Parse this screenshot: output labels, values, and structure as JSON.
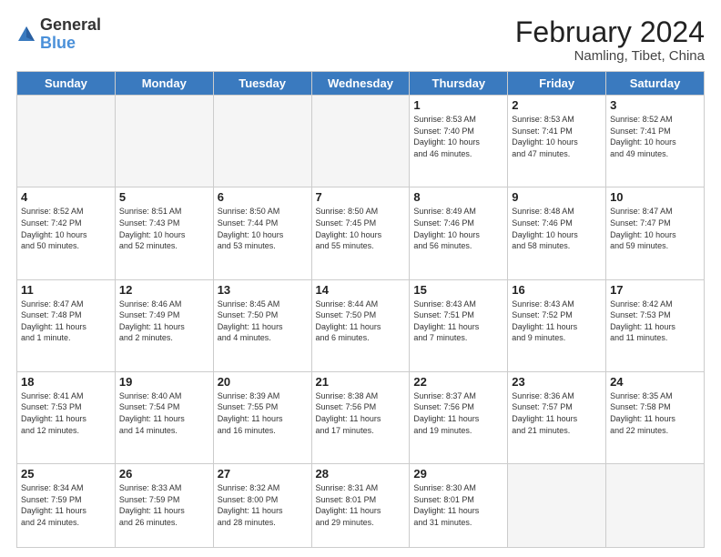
{
  "header": {
    "logo_general": "General",
    "logo_blue": "Blue",
    "month_year": "February 2024",
    "location": "Namling, Tibet, China"
  },
  "days_of_week": [
    "Sunday",
    "Monday",
    "Tuesday",
    "Wednesday",
    "Thursday",
    "Friday",
    "Saturday"
  ],
  "weeks": [
    [
      {
        "day": "",
        "info": "",
        "empty": true
      },
      {
        "day": "",
        "info": "",
        "empty": true
      },
      {
        "day": "",
        "info": "",
        "empty": true
      },
      {
        "day": "",
        "info": "",
        "empty": true
      },
      {
        "day": "1",
        "info": "Sunrise: 8:53 AM\nSunset: 7:40 PM\nDaylight: 10 hours\nand 46 minutes.",
        "empty": false
      },
      {
        "day": "2",
        "info": "Sunrise: 8:53 AM\nSunset: 7:41 PM\nDaylight: 10 hours\nand 47 minutes.",
        "empty": false
      },
      {
        "day": "3",
        "info": "Sunrise: 8:52 AM\nSunset: 7:41 PM\nDaylight: 10 hours\nand 49 minutes.",
        "empty": false
      }
    ],
    [
      {
        "day": "4",
        "info": "Sunrise: 8:52 AM\nSunset: 7:42 PM\nDaylight: 10 hours\nand 50 minutes.",
        "empty": false
      },
      {
        "day": "5",
        "info": "Sunrise: 8:51 AM\nSunset: 7:43 PM\nDaylight: 10 hours\nand 52 minutes.",
        "empty": false
      },
      {
        "day": "6",
        "info": "Sunrise: 8:50 AM\nSunset: 7:44 PM\nDaylight: 10 hours\nand 53 minutes.",
        "empty": false
      },
      {
        "day": "7",
        "info": "Sunrise: 8:50 AM\nSunset: 7:45 PM\nDaylight: 10 hours\nand 55 minutes.",
        "empty": false
      },
      {
        "day": "8",
        "info": "Sunrise: 8:49 AM\nSunset: 7:46 PM\nDaylight: 10 hours\nand 56 minutes.",
        "empty": false
      },
      {
        "day": "9",
        "info": "Sunrise: 8:48 AM\nSunset: 7:46 PM\nDaylight: 10 hours\nand 58 minutes.",
        "empty": false
      },
      {
        "day": "10",
        "info": "Sunrise: 8:47 AM\nSunset: 7:47 PM\nDaylight: 10 hours\nand 59 minutes.",
        "empty": false
      }
    ],
    [
      {
        "day": "11",
        "info": "Sunrise: 8:47 AM\nSunset: 7:48 PM\nDaylight: 11 hours\nand 1 minute.",
        "empty": false
      },
      {
        "day": "12",
        "info": "Sunrise: 8:46 AM\nSunset: 7:49 PM\nDaylight: 11 hours\nand 2 minutes.",
        "empty": false
      },
      {
        "day": "13",
        "info": "Sunrise: 8:45 AM\nSunset: 7:50 PM\nDaylight: 11 hours\nand 4 minutes.",
        "empty": false
      },
      {
        "day": "14",
        "info": "Sunrise: 8:44 AM\nSunset: 7:50 PM\nDaylight: 11 hours\nand 6 minutes.",
        "empty": false
      },
      {
        "day": "15",
        "info": "Sunrise: 8:43 AM\nSunset: 7:51 PM\nDaylight: 11 hours\nand 7 minutes.",
        "empty": false
      },
      {
        "day": "16",
        "info": "Sunrise: 8:43 AM\nSunset: 7:52 PM\nDaylight: 11 hours\nand 9 minutes.",
        "empty": false
      },
      {
        "day": "17",
        "info": "Sunrise: 8:42 AM\nSunset: 7:53 PM\nDaylight: 11 hours\nand 11 minutes.",
        "empty": false
      }
    ],
    [
      {
        "day": "18",
        "info": "Sunrise: 8:41 AM\nSunset: 7:53 PM\nDaylight: 11 hours\nand 12 minutes.",
        "empty": false
      },
      {
        "day": "19",
        "info": "Sunrise: 8:40 AM\nSunset: 7:54 PM\nDaylight: 11 hours\nand 14 minutes.",
        "empty": false
      },
      {
        "day": "20",
        "info": "Sunrise: 8:39 AM\nSunset: 7:55 PM\nDaylight: 11 hours\nand 16 minutes.",
        "empty": false
      },
      {
        "day": "21",
        "info": "Sunrise: 8:38 AM\nSunset: 7:56 PM\nDaylight: 11 hours\nand 17 minutes.",
        "empty": false
      },
      {
        "day": "22",
        "info": "Sunrise: 8:37 AM\nSunset: 7:56 PM\nDaylight: 11 hours\nand 19 minutes.",
        "empty": false
      },
      {
        "day": "23",
        "info": "Sunrise: 8:36 AM\nSunset: 7:57 PM\nDaylight: 11 hours\nand 21 minutes.",
        "empty": false
      },
      {
        "day": "24",
        "info": "Sunrise: 8:35 AM\nSunset: 7:58 PM\nDaylight: 11 hours\nand 22 minutes.",
        "empty": false
      }
    ],
    [
      {
        "day": "25",
        "info": "Sunrise: 8:34 AM\nSunset: 7:59 PM\nDaylight: 11 hours\nand 24 minutes.",
        "empty": false
      },
      {
        "day": "26",
        "info": "Sunrise: 8:33 AM\nSunset: 7:59 PM\nDaylight: 11 hours\nand 26 minutes.",
        "empty": false
      },
      {
        "day": "27",
        "info": "Sunrise: 8:32 AM\nSunset: 8:00 PM\nDaylight: 11 hours\nand 28 minutes.",
        "empty": false
      },
      {
        "day": "28",
        "info": "Sunrise: 8:31 AM\nSunset: 8:01 PM\nDaylight: 11 hours\nand 29 minutes.",
        "empty": false
      },
      {
        "day": "29",
        "info": "Sunrise: 8:30 AM\nSunset: 8:01 PM\nDaylight: 11 hours\nand 31 minutes.",
        "empty": false
      },
      {
        "day": "",
        "info": "",
        "empty": true
      },
      {
        "day": "",
        "info": "",
        "empty": true
      }
    ]
  ]
}
